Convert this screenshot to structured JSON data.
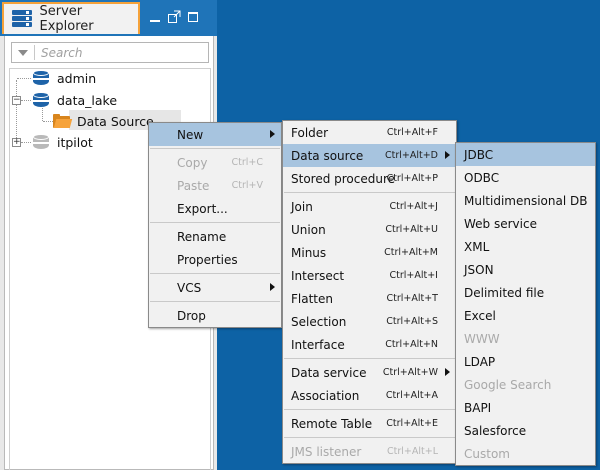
{
  "panel": {
    "tab_title": "Server Explorer",
    "search_placeholder": "Search"
  },
  "tree": {
    "nodes": [
      {
        "label": "admin",
        "icon": "database-icon"
      },
      {
        "label": "data_lake",
        "icon": "database-icon"
      },
      {
        "label": "Data Source",
        "icon": "folder-icon"
      },
      {
        "label": "itpilot",
        "icon": "database-icon"
      }
    ]
  },
  "context_menu": {
    "items": [
      {
        "label": "New",
        "has_submenu": true,
        "enabled": true
      },
      {
        "label": "Copy",
        "shortcut": "Ctrl+C",
        "enabled": false
      },
      {
        "label": "Paste",
        "shortcut": "Ctrl+V",
        "enabled": false
      },
      {
        "label": "Export...",
        "enabled": true
      },
      {
        "label": "Rename",
        "enabled": true
      },
      {
        "label": "Properties",
        "enabled": true
      },
      {
        "label": "VCS",
        "has_submenu": true,
        "enabled": true
      },
      {
        "label": "Drop",
        "enabled": true
      }
    ]
  },
  "new_menu": {
    "items": [
      {
        "label": "Folder",
        "shortcut": "Ctrl+Alt+F"
      },
      {
        "label": "Data source",
        "shortcut": "Ctrl+Alt+D",
        "has_submenu": true
      },
      {
        "label": "Stored procedure",
        "shortcut": "Ctrl+Alt+P"
      },
      {
        "label": "Join",
        "shortcut": "Ctrl+Alt+J"
      },
      {
        "label": "Union",
        "shortcut": "Ctrl+Alt+U"
      },
      {
        "label": "Minus",
        "shortcut": "Ctrl+Alt+M"
      },
      {
        "label": "Intersect",
        "shortcut": "Ctrl+Alt+I"
      },
      {
        "label": "Flatten",
        "shortcut": "Ctrl+Alt+T"
      },
      {
        "label": "Selection",
        "shortcut": "Ctrl+Alt+S"
      },
      {
        "label": "Interface",
        "shortcut": "Ctrl+Alt+N"
      },
      {
        "label": "Data service",
        "shortcut": "Ctrl+Alt+W",
        "has_submenu": true
      },
      {
        "label": "Association",
        "shortcut": "Ctrl+Alt+A"
      },
      {
        "label": "Remote Table",
        "shortcut": "Ctrl+Alt+E"
      },
      {
        "label": "JMS listener",
        "shortcut": "Ctrl+Alt+L",
        "enabled": false
      }
    ]
  },
  "datasource_menu": {
    "items": [
      {
        "label": "JDBC",
        "enabled": true
      },
      {
        "label": "ODBC",
        "enabled": true
      },
      {
        "label": "Multidimensional DB",
        "enabled": true
      },
      {
        "label": "Web service",
        "enabled": true
      },
      {
        "label": "XML",
        "enabled": true
      },
      {
        "label": "JSON",
        "enabled": true
      },
      {
        "label": "Delimited file",
        "enabled": true
      },
      {
        "label": "Excel",
        "enabled": true
      },
      {
        "label": "WWW",
        "enabled": false
      },
      {
        "label": "LDAP",
        "enabled": true
      },
      {
        "label": "Google Search",
        "enabled": false
      },
      {
        "label": "BAPI",
        "enabled": true
      },
      {
        "label": "Salesforce",
        "enabled": true
      },
      {
        "label": "Custom",
        "enabled": false
      }
    ]
  },
  "colors": {
    "desktop": "#0d62a5",
    "header": "#1f74b8",
    "tab_accent": "#f5a23a",
    "highlight": "#a7c4df",
    "database_icon": "#1e63a8",
    "folder_icon": "#f6a33b"
  }
}
